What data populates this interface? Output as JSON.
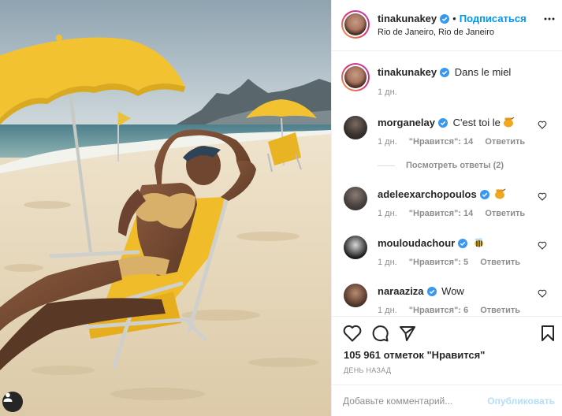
{
  "post_header": {
    "username": "tinakunakey",
    "dot": "•",
    "follow_label": "Подписаться",
    "location": "Rio de Janeiro, Rio de Janeiro"
  },
  "caption": {
    "username": "tinakunakey",
    "text": "Dans le miel",
    "time": "1 дн."
  },
  "comments": [
    {
      "username": "morganelay",
      "text": "C'est toi le",
      "time": "1 дн.",
      "likes": "\"Нравится\": 14",
      "reply": "Ответить",
      "emoji": "honey-pot-icon"
    },
    {
      "username": "adeleexarchopoulos",
      "text": "",
      "time": "1 дн.",
      "likes": "\"Нравится\": 14",
      "reply": "Ответить",
      "emoji": "honey-pot-icon"
    },
    {
      "username": "mouloudachour",
      "text": "",
      "time": "1 дн.",
      "likes": "\"Нравится\": 5",
      "reply": "Ответить",
      "emoji": "bee-icon"
    },
    {
      "username": "naraaziza",
      "text": "Wow",
      "time": "1 дн.",
      "likes": "\"Нравится\": 6",
      "reply": "Ответить"
    }
  ],
  "view_replies": "Посмотреть ответы (2)",
  "likes_count": "105 961 отметок \"Нравится\"",
  "date": "ДЕНЬ НАЗАД",
  "add_comment": {
    "placeholder": "Добавьте комментарий...",
    "publish": "Опубликовать"
  },
  "colors": {
    "accent": "#0095f6",
    "verified": "#3897f0",
    "umbrella": "#f2c230",
    "sand": "#e9dcc4"
  }
}
